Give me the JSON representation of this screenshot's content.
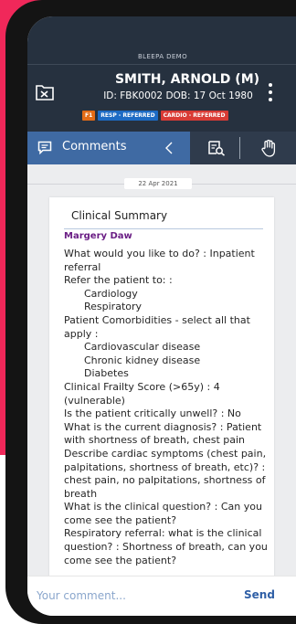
{
  "header": {
    "demo_label": "BLEEPA DEMO",
    "patient_name": "SMITH, ARNOLD (M)",
    "patient_id_line": "ID: FBK0002   DOB: 17 Oct 1980",
    "tags": [
      {
        "label": "F1",
        "color": "#e46c17"
      },
      {
        "label": "RESP - REFERRED",
        "color": "#1d6bc4"
      },
      {
        "label": "CARDIO - REFERRED",
        "color": "#d93b35"
      }
    ],
    "icons": {
      "left": "folder-close-icon",
      "right": "more-vertical-icon"
    }
  },
  "tabbar": {
    "comments_label": "Comments",
    "icons": [
      "comments-icon",
      "chevron-left-icon",
      "document-search-icon",
      "hand-icon"
    ]
  },
  "thread": {
    "date": "22 Apr 2021",
    "card": {
      "title": "Clinical Summary",
      "author": "Margery Daw",
      "lines": [
        {
          "text": "What would you like to do? : Inpatient",
          "indent": false
        },
        {
          "text": "referral",
          "indent": false
        },
        {
          "text": "Refer the patient to: :",
          "indent": false
        },
        {
          "text": "Cardiology",
          "indent": true
        },
        {
          "text": "Respiratory",
          "indent": true
        },
        {
          "text": "Patient Comorbidities - select all that",
          "indent": false
        },
        {
          "text": "apply :",
          "indent": false
        },
        {
          "text": "Cardiovascular disease",
          "indent": true
        },
        {
          "text": "Chronic kidney disease",
          "indent": true
        },
        {
          "text": "Diabetes",
          "indent": true
        },
        {
          "text": "Clinical Frailty Score (>65y) : 4",
          "indent": false
        },
        {
          "text": "(vulnerable)",
          "indent": false
        },
        {
          "text": "Is the patient critically unwell? : No",
          "indent": false
        },
        {
          "text": "What is the current diagnosis? : Patient",
          "indent": false
        },
        {
          "text": "with shortness of breath, chest pain",
          "indent": false
        },
        {
          "text": "Describe cardiac symptoms (chest pain,",
          "indent": false
        },
        {
          "text": "palpitations, shortness of breath, etc)? :",
          "indent": false
        },
        {
          "text": "chest pain, no palpitations, shortness of",
          "indent": false
        },
        {
          "text": "breath",
          "indent": false
        },
        {
          "text": "What is the clinical question? : Can you",
          "indent": false
        },
        {
          "text": "come see the patient?",
          "indent": false
        },
        {
          "text": "Respiratory referral: what is the clinical",
          "indent": false
        },
        {
          "text": "question? : Shortness of breath, can you",
          "indent": false
        },
        {
          "text": "come see the patient?",
          "indent": false
        }
      ]
    }
  },
  "composer": {
    "placeholder": "Your comment...",
    "send_label": "Send"
  },
  "colors": {
    "background_accent": "#f0285a",
    "header_bg": "#26313f",
    "active_tab": "#3f6aa3",
    "author": "#6b1f85",
    "send": "#2f5fa6"
  }
}
